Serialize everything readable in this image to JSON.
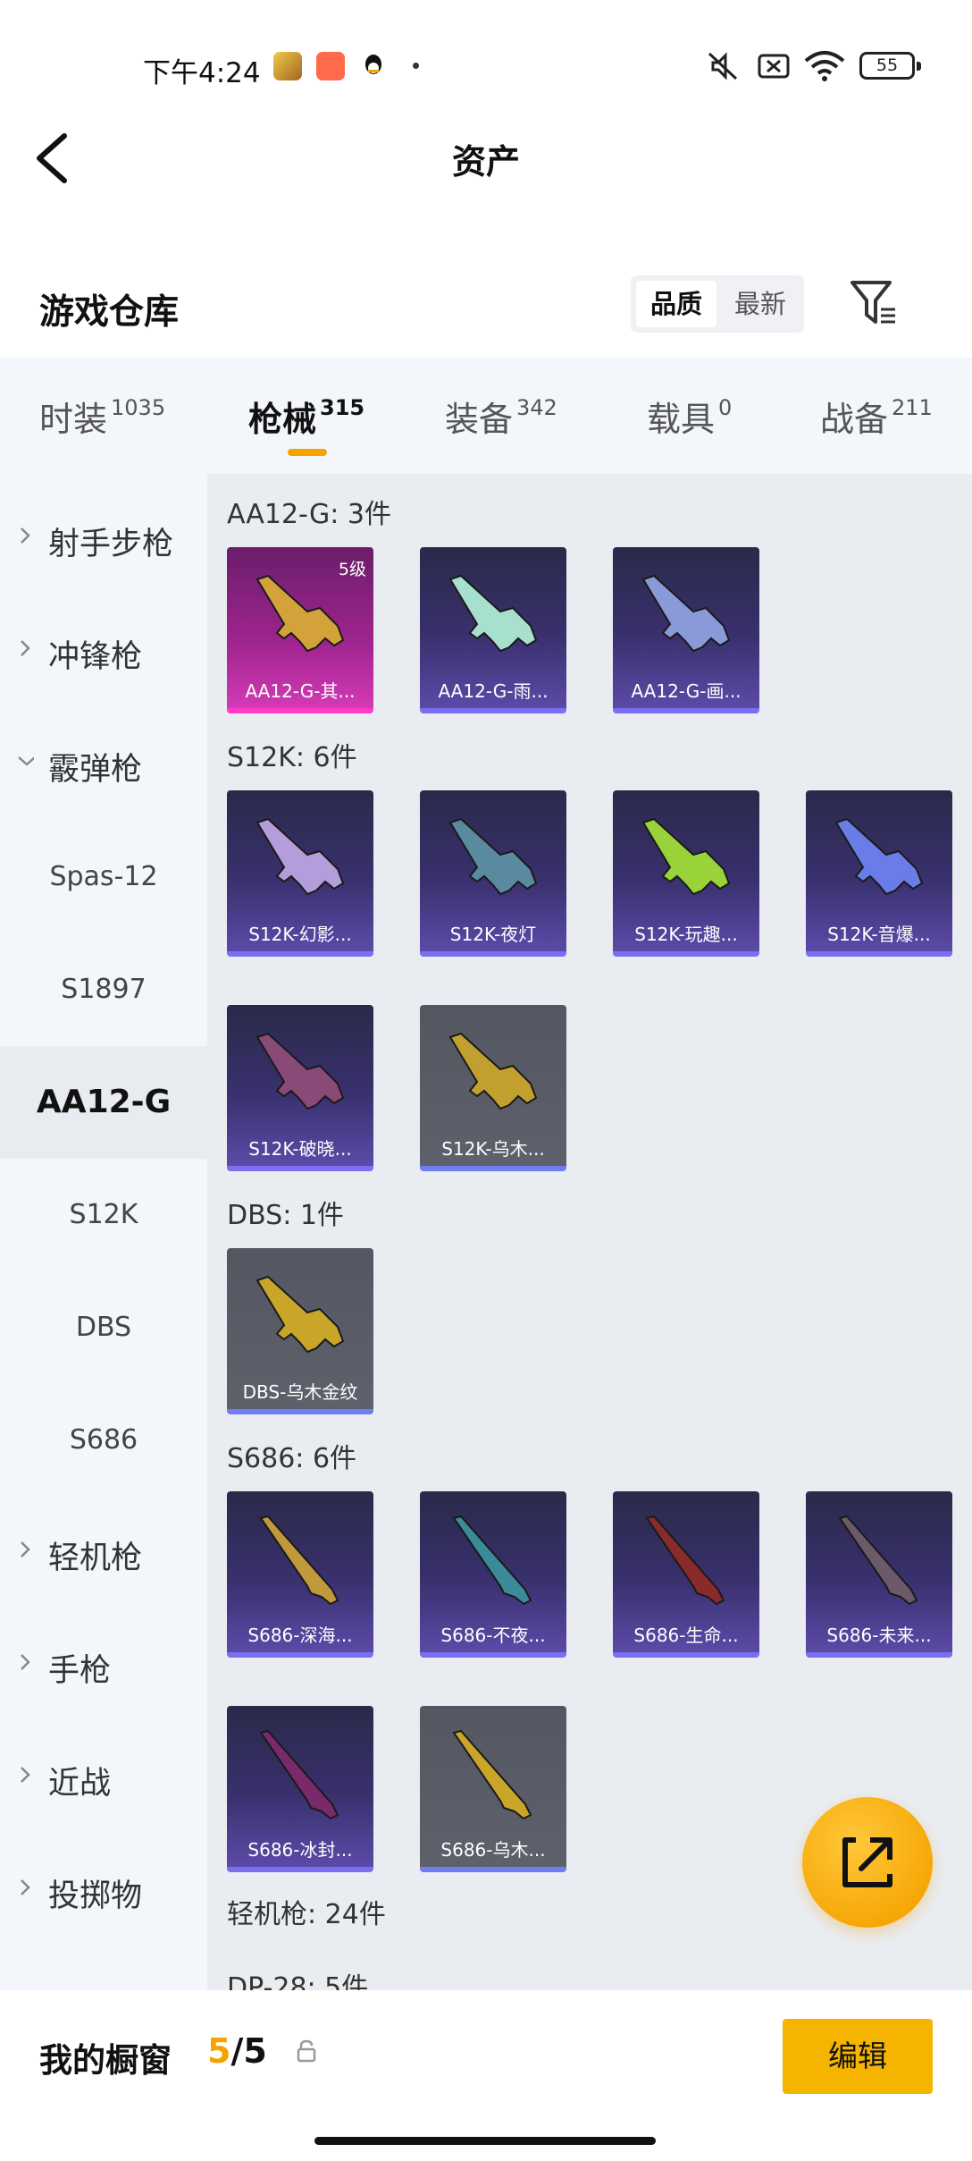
{
  "status_bar": {
    "time": "下午4:24",
    "battery": "55"
  },
  "header": {
    "title": "资产"
  },
  "warehouse": {
    "title": "游戏仓库",
    "sort_options": [
      "品质",
      "最新"
    ],
    "active_sort": "品质"
  },
  "tabs": [
    {
      "label": "时装",
      "count": "1035"
    },
    {
      "label": "枪械",
      "count": "315",
      "active": true
    },
    {
      "label": "装备",
      "count": "342"
    },
    {
      "label": "载具",
      "count": "0"
    },
    {
      "label": "战备",
      "count": "211"
    }
  ],
  "sidebar": {
    "categories": [
      {
        "label": "射手步枪",
        "expanded": false
      },
      {
        "label": "冲锋枪",
        "expanded": false
      },
      {
        "label": "霰弹枪",
        "expanded": true
      },
      {
        "label": "轻机枪",
        "expanded": false
      },
      {
        "label": "手枪",
        "expanded": false
      },
      {
        "label": "近战",
        "expanded": false
      },
      {
        "label": "投掷物",
        "expanded": false
      }
    ],
    "shotgun_sub": [
      "Spas-12",
      "S1897",
      "AA12-G",
      "S12K",
      "DBS",
      "S686"
    ],
    "active_sub": "AA12-G"
  },
  "groups": [
    {
      "title": "AA12-G: 3件",
      "items": [
        {
          "label": "AA12-G-其...",
          "style": "pink",
          "level": "5级",
          "accent": "#d4a23a"
        },
        {
          "label": "AA12-G-雨...",
          "style": "purple",
          "accent": "#a8e0d0"
        },
        {
          "label": "AA12-G-画...",
          "style": "purple",
          "accent": "#8a9ad8"
        }
      ]
    },
    {
      "title": "S12K: 6件",
      "items": [
        {
          "label": "S12K-幻影...",
          "style": "purple",
          "accent": "#b39ddb"
        },
        {
          "label": "S12K-夜灯",
          "style": "purple",
          "accent": "#5a8aa0"
        },
        {
          "label": "S12K-玩趣...",
          "style": "purple",
          "accent": "#9ad23a"
        },
        {
          "label": "S12K-音爆...",
          "style": "purple",
          "accent": "#6a7ce8"
        },
        {
          "label": "S12K-破晓...",
          "style": "purple",
          "accent": "#8a4a78"
        },
        {
          "label": "S12K-乌木...",
          "style": "gray",
          "accent": "#c2a030"
        }
      ]
    },
    {
      "title": "DBS: 1件",
      "items": [
        {
          "label": "DBS-乌木金纹",
          "style": "gray",
          "accent": "#c9a52a"
        }
      ]
    },
    {
      "title": "S686: 6件",
      "items": [
        {
          "label": "S686-深海...",
          "style": "purple",
          "accent": "#c09a3a"
        },
        {
          "label": "S686-不夜...",
          "style": "purple",
          "accent": "#3a8a9a"
        },
        {
          "label": "S686-生命...",
          "style": "purple",
          "accent": "#8a2a2a"
        },
        {
          "label": "S686-未来...",
          "style": "purple",
          "accent": "#6a5a6a"
        },
        {
          "label": "S686-冰封...",
          "style": "purple",
          "accent": "#7a2a6a"
        },
        {
          "label": "S686-乌木...",
          "style": "gray",
          "accent": "#c9a52a"
        }
      ]
    }
  ],
  "lmg_title": "轻机枪: 24件",
  "next_title": "DP-28: 5件",
  "showcase": {
    "title": "我的橱窗",
    "current": "5",
    "separator": "/",
    "total": "5",
    "edit_label": "编辑"
  }
}
